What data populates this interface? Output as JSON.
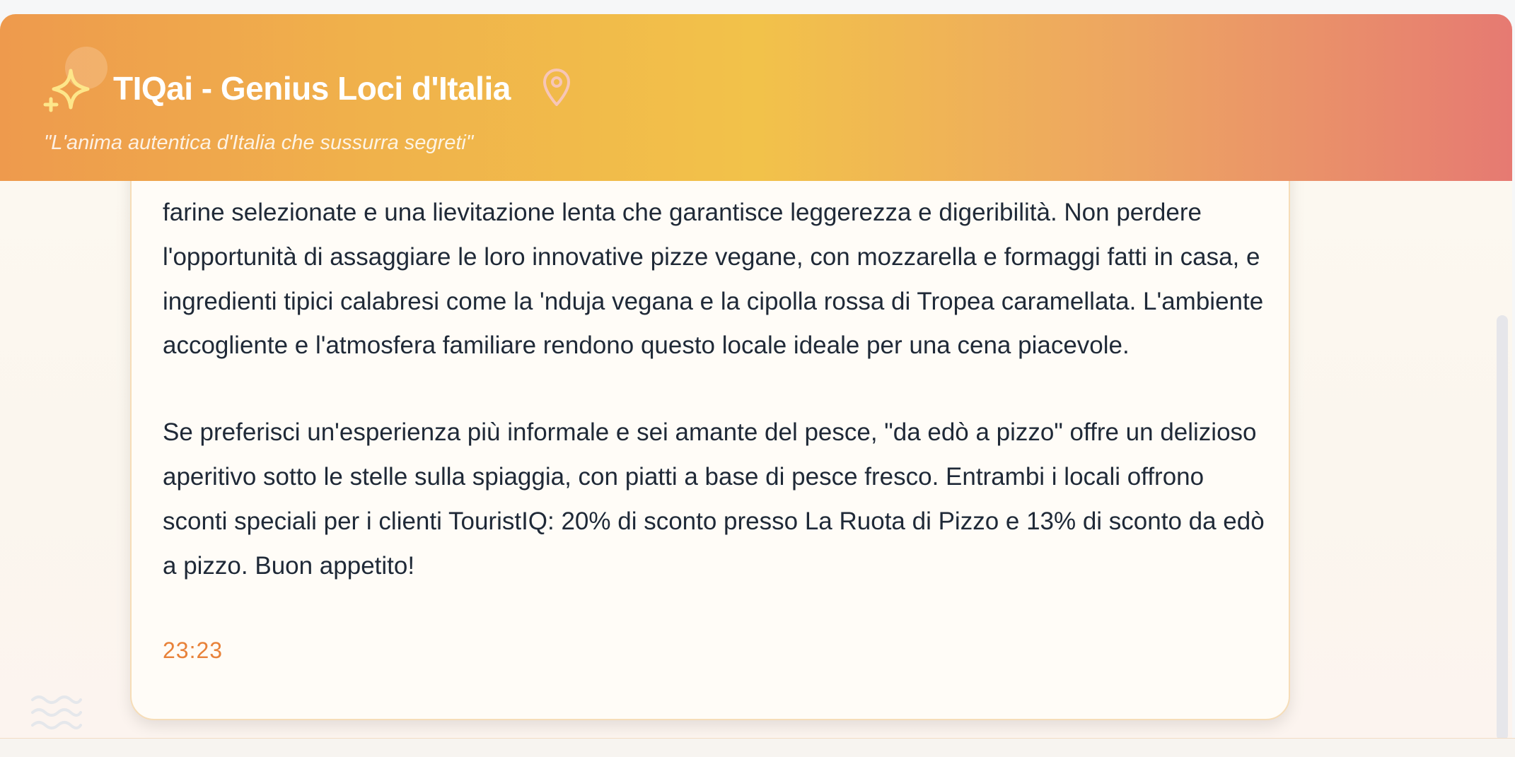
{
  "header": {
    "title": "TIQai - Genius Loci d'Italia",
    "subtitle": "\"L'anima autentica d'Italia che sussurra segreti\"",
    "logo_icon": "sparkle-icon",
    "location_icon": "map-pin-icon"
  },
  "message": {
    "paragraphs": [
      "farine selezionate e una lievitazione lenta che garantisce leggerezza e digeribilità. Non perdere l'opportunità di assaggiare le loro innovative pizze vegane, con mozzarella e formaggi fatti in casa, e ingredienti tipici calabresi come la 'nduja vegana e la cipolla rossa di Tropea caramellata. L'ambiente accogliente e l'atmosfera familiare rendono questo locale ideale per una cena piacevole.",
      "Se preferisci un'esperienza più informale e sei amante del pesce, \"da edò a pizzo\" offre un delizioso aperitivo sotto le stelle sulla spiaggia, con piatti a base di pesce fresco. Entrambi i locali offrono sconti speciali per i clienti TouristIQ: 20% di sconto presso La Ruota di Pizzo e 13% di sconto da edò a pizzo. Buon appetito!"
    ],
    "timestamp": "23:23"
  },
  "decor": {
    "waves_icon": "waves-icon"
  },
  "colors": {
    "accent": "#e8823a",
    "header_gradient_start": "#ee9a4d",
    "header_gradient_mid": "#f2c24a",
    "header_gradient_end": "#e67a72",
    "text": "#1f2937"
  }
}
